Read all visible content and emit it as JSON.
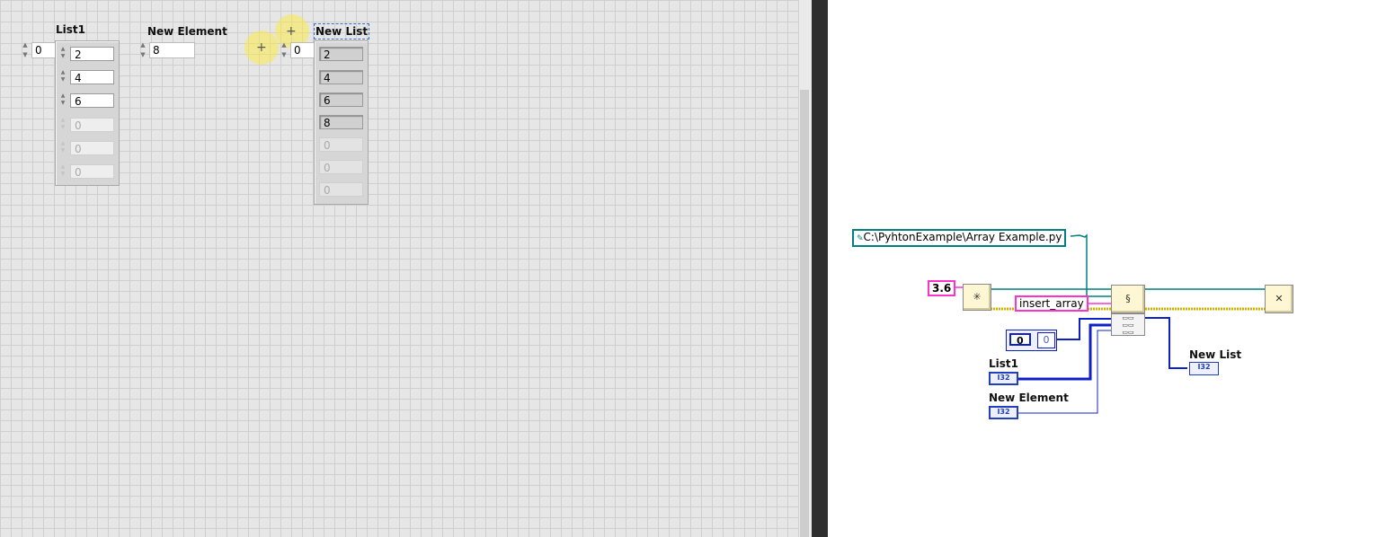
{
  "front_panel": {
    "list1": {
      "label": "List1",
      "index": "0",
      "elements": [
        "2",
        "4",
        "6"
      ],
      "empty_elements": [
        "0",
        "0",
        "0"
      ]
    },
    "new_element": {
      "label": "New Element",
      "value": "8"
    },
    "new_list": {
      "label": "New List",
      "index": "0",
      "elements": [
        "2",
        "4",
        "6",
        "8"
      ],
      "empty_elements": [
        "0",
        "0",
        "0"
      ]
    }
  },
  "block_diagram": {
    "path_constant": "C:\\PyhtonExample\\Array Example.py",
    "version_constant": "3.6",
    "function_name": "insert_array",
    "array_const_index": "0",
    "array_const_value": "0",
    "terminals": {
      "list1": {
        "label": "List1",
        "type": "I32"
      },
      "new_element": {
        "label": "New Element",
        "type": "I32"
      },
      "new_list": {
        "label": "New List",
        "type": "I32"
      }
    },
    "icons": {
      "open_session": "python-open-session-icon",
      "python_node": "python-node-icon",
      "close_session": "python-close-session-icon",
      "path_glyph": "path-icon"
    },
    "colors": {
      "path_wire": "#008080",
      "string_wire": "#ff33cc",
      "refnum_wire": "#d4b000",
      "numeric_wire": "#1020c8"
    }
  }
}
